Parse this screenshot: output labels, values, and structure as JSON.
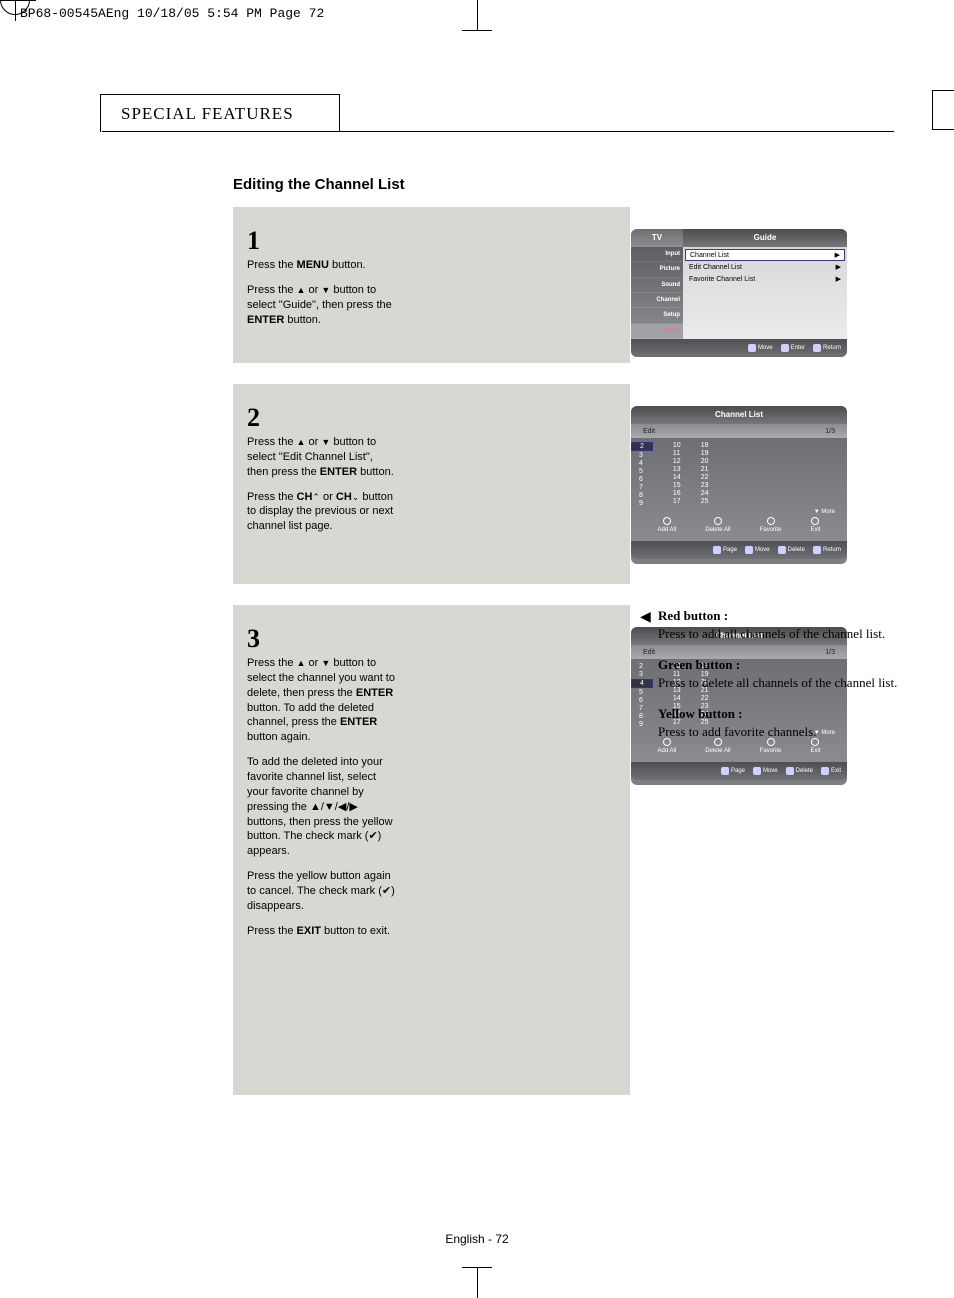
{
  "print_header": "BP68-00545AEng  10/18/05  5:54 PM  Page 72",
  "section_header": "SPECIAL FEATURES",
  "title": "Editing the Channel List",
  "steps": {
    "s1": {
      "num": "1",
      "p1a": "Press the ",
      "p1b": "MENU",
      "p1c": " button.",
      "p2a": "Press the ",
      "p2b": " or ",
      "p2c": " button to select \"Guide\", then press the ",
      "p2d": "ENTER",
      "p2e": " button."
    },
    "s2": {
      "num": "2",
      "p1a": "Press the ",
      "p1b": " or ",
      "p1c": " button to select \"Edit Channel List\", then press the ",
      "p1d": "ENTER",
      "p1e": " button.",
      "p2a": "Press the ",
      "p2b": "CH",
      "p2c": " or ",
      "p2d": "CH",
      "p2e": " button to display the previous or next channel list page."
    },
    "s3": {
      "num": "3",
      "p1a": "Press the ",
      "p1b": " or ",
      "p1c": " button to select the channel you want to delete, then press the ",
      "p1d": "ENTER",
      "p1e": " button. To add the deleted channel, press the ",
      "p1f": "ENTER",
      "p1g": " button again.",
      "p2": "To add the deleted into your favorite channel list, select your favorite channel by pressing the ▲/▼/◀/▶ buttons, then press the yellow button. The check mark (✔) appears.",
      "p2b": "Press the yellow button again to cancel. The check mark (✔) disappears.",
      "p3a": "Press the ",
      "p3b": "EXIT",
      "p3c": " button to exit."
    }
  },
  "osd1": {
    "top_left": "TV",
    "top_right": "Guide",
    "side": [
      "Input",
      "Picture",
      "Sound",
      "Channel",
      "Setup",
      "Guide"
    ],
    "rows": [
      {
        "label": "Channel List",
        "arrow": "▶"
      },
      {
        "label": "Edit Channel List",
        "arrow": "▶"
      },
      {
        "label": "Favorite Channel List",
        "arrow": "▶"
      }
    ],
    "bb": [
      "Move",
      "Enter",
      "Return"
    ]
  },
  "osd2": {
    "title": "Channel List",
    "edit": "Edit",
    "page": "1/3",
    "col1": [
      "2",
      "3",
      "4",
      "5",
      "6",
      "7",
      "8",
      "9"
    ],
    "col2": [
      "10",
      "11",
      "12",
      "13",
      "14",
      "15",
      "16",
      "17"
    ],
    "col3": [
      "18",
      "19",
      "20",
      "21",
      "22",
      "23",
      "24",
      "25"
    ],
    "more": "▼ More",
    "actions": [
      "Add All",
      "Delete All",
      "Favorite",
      "Exit"
    ],
    "bb": [
      "Page",
      "Move",
      "Delete",
      "Return"
    ],
    "sel_index": 0
  },
  "osd3": {
    "title": "Channel List",
    "edit": "Edit",
    "page": "1/3",
    "col1": [
      "2",
      "3",
      "4",
      "5",
      "6",
      "7",
      "8",
      "9"
    ],
    "col2": [
      "10",
      "11",
      "12",
      "13",
      "14",
      "15",
      "16",
      "17"
    ],
    "col3": [
      "18",
      "19",
      "20",
      "21",
      "22",
      "23",
      "24",
      "25"
    ],
    "more": "▼ More",
    "actions": [
      "Add All",
      "Delete All",
      "Favorite",
      "Exit"
    ],
    "bb": [
      "Page",
      "Move",
      "Delete",
      "Exit"
    ],
    "sel_index": 2
  },
  "annotations": {
    "a1_head": "Red button :",
    "a1_body": "Press to add all channels of the channel list.",
    "a2_head": "Green button :",
    "a2_body": "Press to delete all channels of the channel list.",
    "a3_head": "Yellow button :",
    "a3_body": "Press to add favorite channels."
  },
  "footer": "English - 72"
}
